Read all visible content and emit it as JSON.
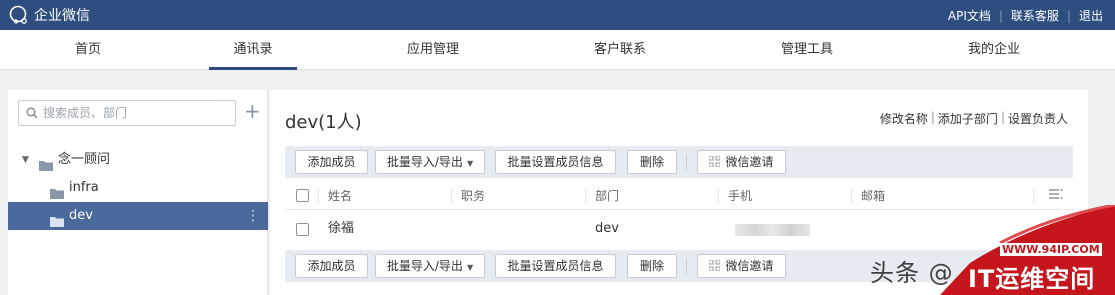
{
  "app": {
    "title": "企业微信"
  },
  "top_links": [
    "API文档",
    "联系客服",
    "退出"
  ],
  "nav": {
    "tabs": [
      {
        "label": "首页"
      },
      {
        "label": "通讯录"
      },
      {
        "label": "应用管理"
      },
      {
        "label": "客户联系"
      },
      {
        "label": "管理工具"
      },
      {
        "label": "我的企业"
      }
    ],
    "active": "通讯录"
  },
  "sidebar": {
    "search_placeholder": "搜索成员、部门",
    "add_symbol": "+",
    "tree": [
      {
        "label": "念一顾问",
        "expanded": true
      },
      {
        "label": "infra"
      },
      {
        "label": "dev",
        "selected": true
      }
    ],
    "more_symbol": "⋮"
  },
  "main": {
    "title": "dev(1人)",
    "title_links": [
      "修改名称",
      "添加子部门",
      "设置负责人"
    ],
    "toolbar": {
      "add_member": "添加成员",
      "batch_import_export": "批量导入/导出",
      "batch_set_info": "批量设置成员信息",
      "delete": "删除",
      "wechat_invite": "微信邀请"
    },
    "columns": [
      "姓名",
      "职务",
      "部门",
      "手机",
      "邮箱"
    ],
    "rows": [
      {
        "name": "徐福",
        "title": "",
        "department": "dev",
        "phone": "",
        "email": ""
      }
    ]
  },
  "watermark": {
    "text": "头条 @",
    "url": "WWW.94IP.COM",
    "brand": "IT运维空间"
  },
  "colors": {
    "topbar": "#2d4e7e",
    "selected": "#4a6a9b",
    "toolbar_bg": "#e6ebf1",
    "watermark_red": "#c4161c"
  }
}
